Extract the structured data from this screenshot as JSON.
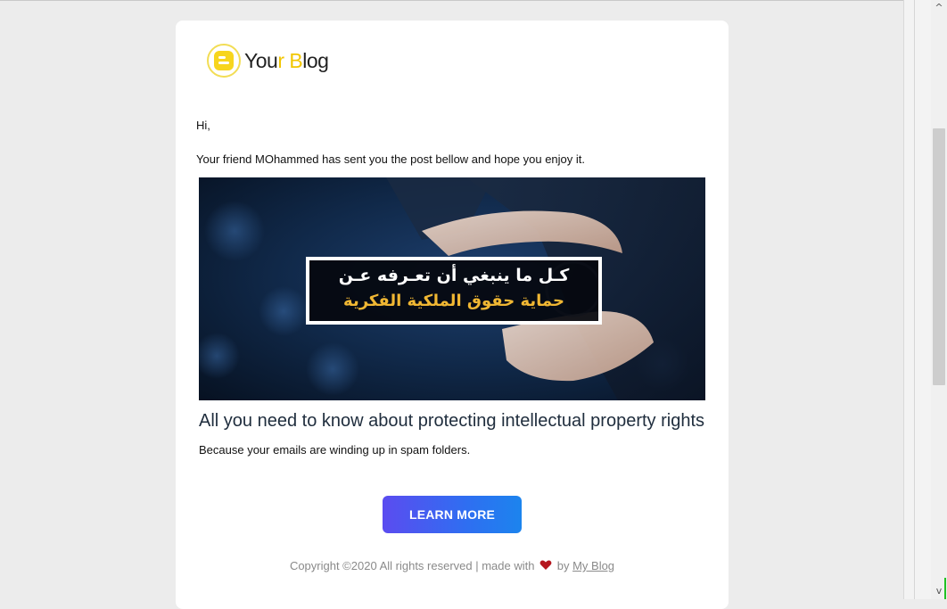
{
  "logo": {
    "text_part1": "You",
    "text_accent": "r B",
    "text_part2": "log",
    "accent_color": "#f2c600",
    "icon": "blogger-icon"
  },
  "email": {
    "greeting": "Hi,",
    "intro": "Your friend MOhammed has sent you the post bellow and hope you enjoy it."
  },
  "post": {
    "image_text_line1": "كـل ما ينبغي أن تعـرفه عـن",
    "image_text_line2": "حماية حقوق الملكية الفكرية",
    "title": "All you need to know about protecting intellectual property rights",
    "summary": "Because your emails are winding up in spam folders."
  },
  "cta": {
    "label": "LEARN MORE"
  },
  "footer": {
    "text_before": "Copyright ©2020 All rights reserved | made with",
    "text_by": "by",
    "link_text": "My Blog",
    "heart_icon": "heart-icon",
    "heart_color": "#b5171f"
  },
  "scrollbar": {
    "up_arrow": "^",
    "down_arrow": "v"
  }
}
